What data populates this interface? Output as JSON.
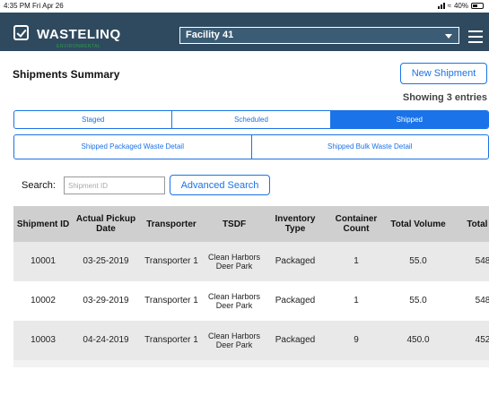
{
  "status_bar": {
    "time": "4:35 PM  Fri Apr 26",
    "battery": "40%"
  },
  "app": {
    "logo_text": "WASTELINQ",
    "logo_sub": "ENVIRONMENTAL",
    "facility": "Facility 41"
  },
  "page": {
    "title": "Shipments Summary",
    "new_shipment_label": "New Shipment",
    "showing": "Showing 3 entries"
  },
  "status_tabs": [
    {
      "label": "Staged"
    },
    {
      "label": "Scheduled"
    },
    {
      "label": "Shipped",
      "active": true
    }
  ],
  "detail_tabs": [
    {
      "label": "Shipped Packaged Waste Detail"
    },
    {
      "label": "Shipped Bulk Waste Detail"
    }
  ],
  "search": {
    "label": "Search:",
    "placeholder": "Shipment ID",
    "value": "",
    "advanced_label": "Advanced Search"
  },
  "table": {
    "headers": [
      "Shipment ID",
      "Actual Pickup Date",
      "Transporter",
      "TSDF",
      "Inventory Type",
      "Container Count",
      "Total Volume",
      "Total W"
    ],
    "rows": [
      [
        "10001",
        "03-25-2019",
        "Transporter 1",
        "Clean Harbors Deer Park",
        "Packaged",
        "1",
        "55.0",
        "548"
      ],
      [
        "10002",
        "03-29-2019",
        "Transporter 1",
        "Clean Harbors Deer Park",
        "Packaged",
        "1",
        "55.0",
        "548"
      ],
      [
        "10003",
        "04-24-2019",
        "Transporter 1",
        "Clean Harbors Deer Park",
        "Packaged",
        "9",
        "450.0",
        "452"
      ]
    ]
  },
  "colors": {
    "appbar": "#2f4a5f",
    "accent": "#1a73e8",
    "header_row": "#cfcfcf",
    "logo_sub": "#2f9a4a"
  }
}
